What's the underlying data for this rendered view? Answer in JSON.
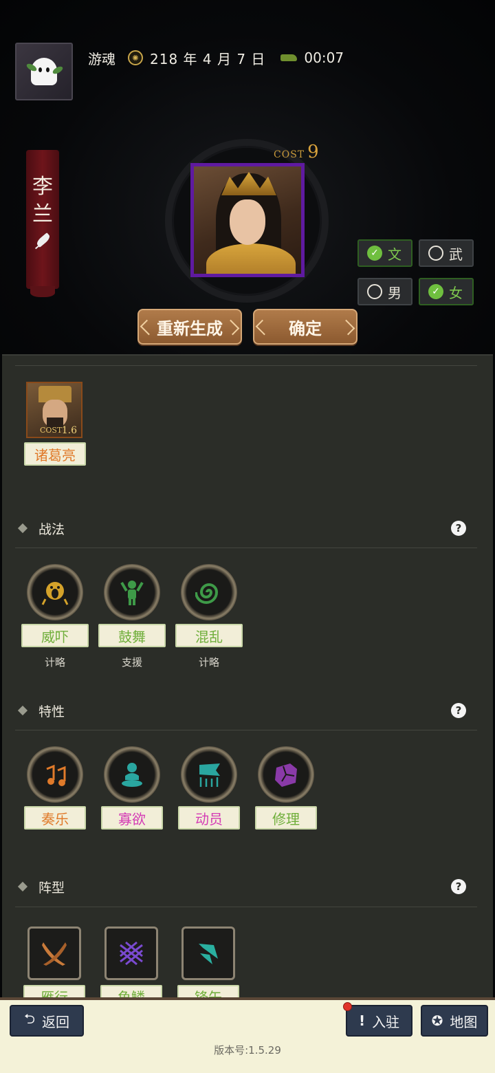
{
  "header": {
    "game_name": "游魂",
    "date": "218 年 4 月 7 日",
    "time": "00:07"
  },
  "character": {
    "name_chars": [
      "李",
      "兰"
    ],
    "cost_label": "COST",
    "cost_value": "9"
  },
  "toggles": {
    "wen": {
      "label": "文",
      "checked": true
    },
    "wu": {
      "label": "武",
      "checked": false
    },
    "male": {
      "label": "男",
      "checked": false
    },
    "female": {
      "label": "女",
      "checked": true
    }
  },
  "actions": {
    "regenerate": "重新生成",
    "confirm": "确定"
  },
  "linked_unit": {
    "name": "诸葛亮",
    "cost_label": "COST",
    "cost_value": "1.6"
  },
  "sections": {
    "tactics": {
      "title": "战法",
      "items": [
        {
          "name": "威吓",
          "type": "计略",
          "icon": "screaming-face-icon",
          "color": "#d4a22a"
        },
        {
          "name": "鼓舞",
          "type": "支援",
          "icon": "cheering-figure-icon",
          "color": "#3e9a48"
        },
        {
          "name": "混乱",
          "type": "计略",
          "icon": "swirl-icon",
          "color": "#3e9a48"
        }
      ]
    },
    "traits": {
      "title": "特性",
      "items": [
        {
          "name": "奏乐",
          "icon": "music-notes-icon",
          "color": "#e07a2a",
          "tag_color": "orange"
        },
        {
          "name": "寡欲",
          "icon": "meditating-figure-icon",
          "color": "#2aa6a0",
          "tag_color": "pink"
        },
        {
          "name": "动员",
          "icon": "banner-spears-icon",
          "color": "#2aa6a0",
          "tag_color": "pink"
        },
        {
          "name": "修理",
          "icon": "broken-block-icon",
          "color": "#8a3aa8",
          "tag_color": "green"
        }
      ]
    },
    "formations": {
      "title": "阵型",
      "items": [
        {
          "name": "雁行",
          "icon": "crossed-blades-icon",
          "color": "#c87a3a"
        },
        {
          "name": "鱼鳞",
          "icon": "crosshatch-icon",
          "color": "#7a4ad0"
        },
        {
          "name": "锋矢",
          "icon": "arrowhead-icon",
          "color": "#2ab0a0"
        }
      ]
    }
  },
  "bottom": {
    "back": "返回",
    "station": "入驻",
    "map": "地图",
    "version": "版本号:1.5.29"
  }
}
